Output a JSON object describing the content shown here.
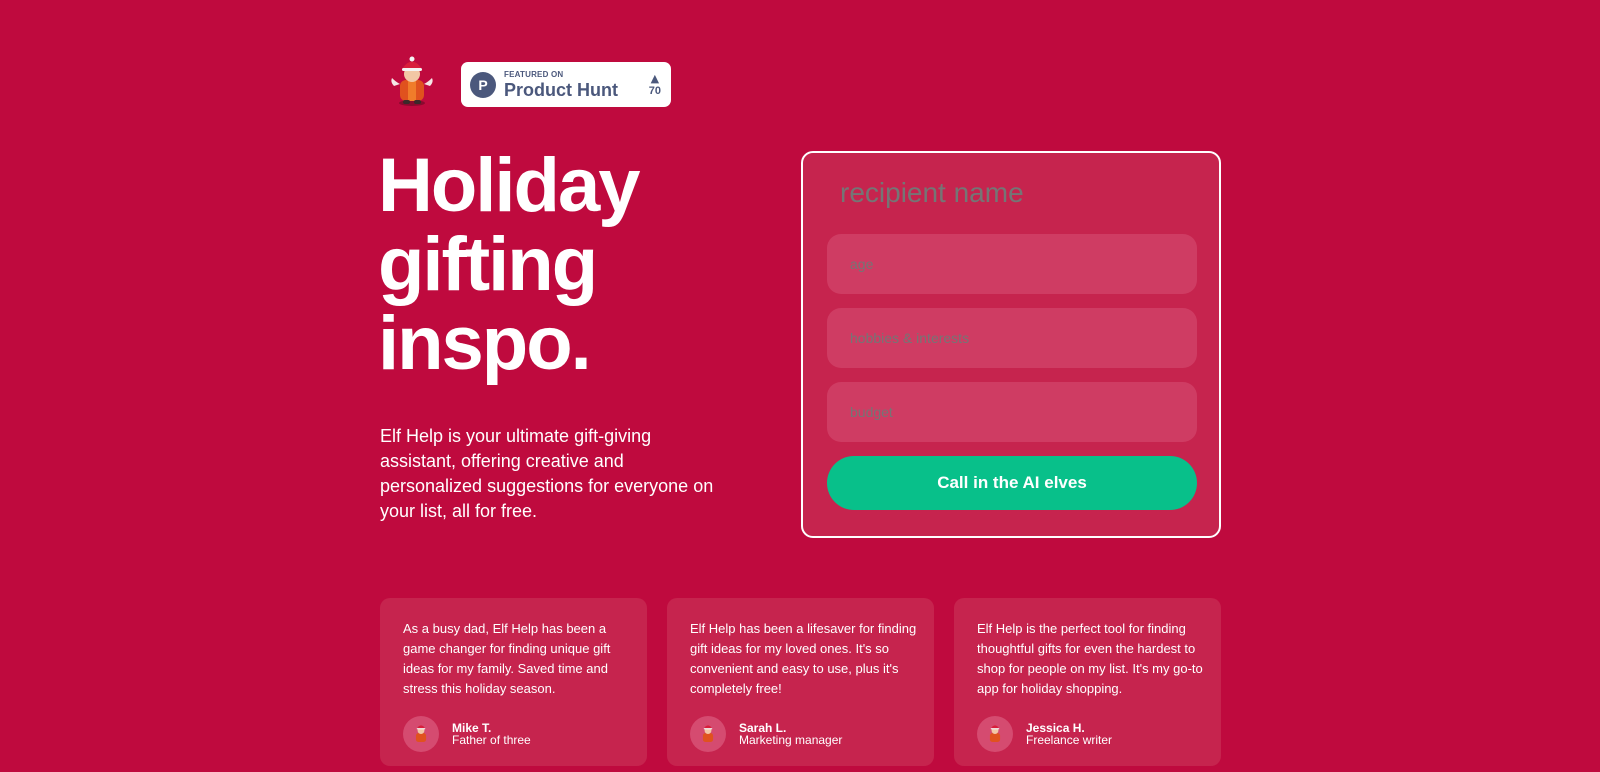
{
  "logo": {
    "icon": "elf-mascot-icon"
  },
  "product_hunt": {
    "featured_on": "FEATURED ON",
    "name": "Product Hunt",
    "votes": "70",
    "arrow": "▲",
    "logo_letter": "P",
    "color": "#4b587c"
  },
  "hero": {
    "headline": [
      "Holiday",
      "gifting",
      "inspo."
    ],
    "description": "Elf Help is your ultimate gift-giving assistant, offering creative and personalized suggestions for everyone on your list, all for free."
  },
  "form": {
    "recipient_placeholder": "recipient name",
    "age_placeholder": "age",
    "hobbies_placeholder": "hobbies & interests",
    "budget_placeholder": "budget",
    "submit_label": "Call in the AI elves"
  },
  "testimonials": [
    {
      "quote": "As a busy dad, Elf Help has been a game changer for finding unique gift ideas for my family. Saved time and stress this holiday season.",
      "name": "Mike T.",
      "role": "Father of three"
    },
    {
      "quote": "Elf Help has been a lifesaver for finding gift ideas for my loved ones. It's so convenient and easy to use, plus it's completely free!",
      "name": "Sarah L.",
      "role": "Marketing manager"
    },
    {
      "quote": "Elf Help is the perfect tool for finding thoughtful gifts for even the hardest to shop for people on my list. It's my go-to app for holiday shopping.",
      "name": "Jessica H.",
      "role": "Freelance writer"
    }
  ],
  "colors": {
    "background": "#bf0a3e",
    "card": "#c6244e",
    "field": "#cf3c63",
    "accent": "#08c08a"
  }
}
